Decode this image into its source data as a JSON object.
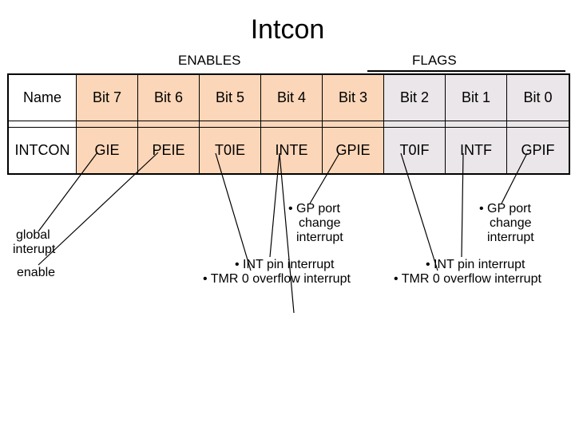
{
  "title": "Intcon",
  "sections": {
    "enables": "ENABLES",
    "flags": "FLAGS"
  },
  "header": {
    "name": "Name",
    "bits": [
      "Bit 7",
      "Bit 6",
      "Bit 5",
      "Bit 4",
      "Bit 3",
      "Bit 2",
      "Bit 1",
      "Bit 0"
    ]
  },
  "row": {
    "name": "INTCON",
    "cells": [
      "GIE",
      "PEIE",
      "T0IE",
      "INTE",
      "GPIE",
      "T0IF",
      "INTF",
      "GPIF"
    ]
  },
  "annotations": {
    "global_l1": "global",
    "global_l2": "interupt",
    "enable": "enable",
    "gp_port_l1": "• GP port",
    "gp_port_l2": "change",
    "gp_port_l3": "interrupt",
    "int_pin": "• INT pin interrupt",
    "tmr0": "• TMR 0 overflow interrupt"
  }
}
